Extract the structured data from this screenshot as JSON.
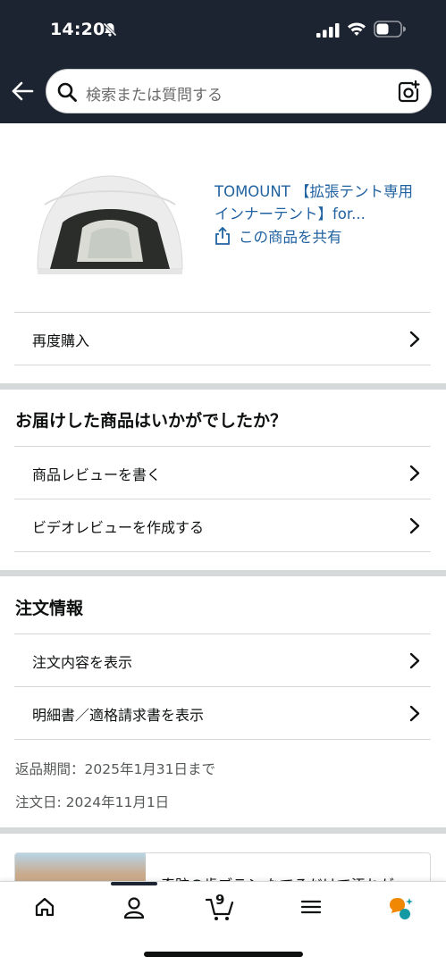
{
  "status_bar": {
    "time": "14:20",
    "icons": [
      "bell-slash-icon",
      "signal-icon",
      "wifi-icon",
      "battery-icon"
    ]
  },
  "header": {
    "search_placeholder": "検索または質問する",
    "icons": [
      "back-arrow-icon",
      "search-icon",
      "camera-icon"
    ]
  },
  "product": {
    "title": "TOMOUNT 【拡張テント専用インナーテント】for...",
    "share_label": "この商品を共有",
    "image": "tent-image"
  },
  "actions": {
    "buy_again": "再度購入"
  },
  "review_section": {
    "title": "お届けした商品はいかがでしたか？",
    "items": [
      "商品レビューを書く",
      "ビデオレビューを作成する"
    ]
  },
  "order_section": {
    "title": "注文情報",
    "items": [
      "注文内容を表示",
      "明細書／適格請求書を表示"
    ],
    "return_period": "返品期間：2025年1月31日まで",
    "order_date": "注文日: 2024年11月1日"
  },
  "ad": {
    "text": "奇跡の歯ブラシ なでるだけで汚れが"
  },
  "tab_bar": {
    "cart_count": "9",
    "tabs": [
      "home-icon",
      "account-icon",
      "cart-icon",
      "menu-icon",
      "rufus-icon"
    ]
  },
  "colors": {
    "header_bg": "#1c2431",
    "link": "#2162a1",
    "divider": "#d5d9d9"
  }
}
